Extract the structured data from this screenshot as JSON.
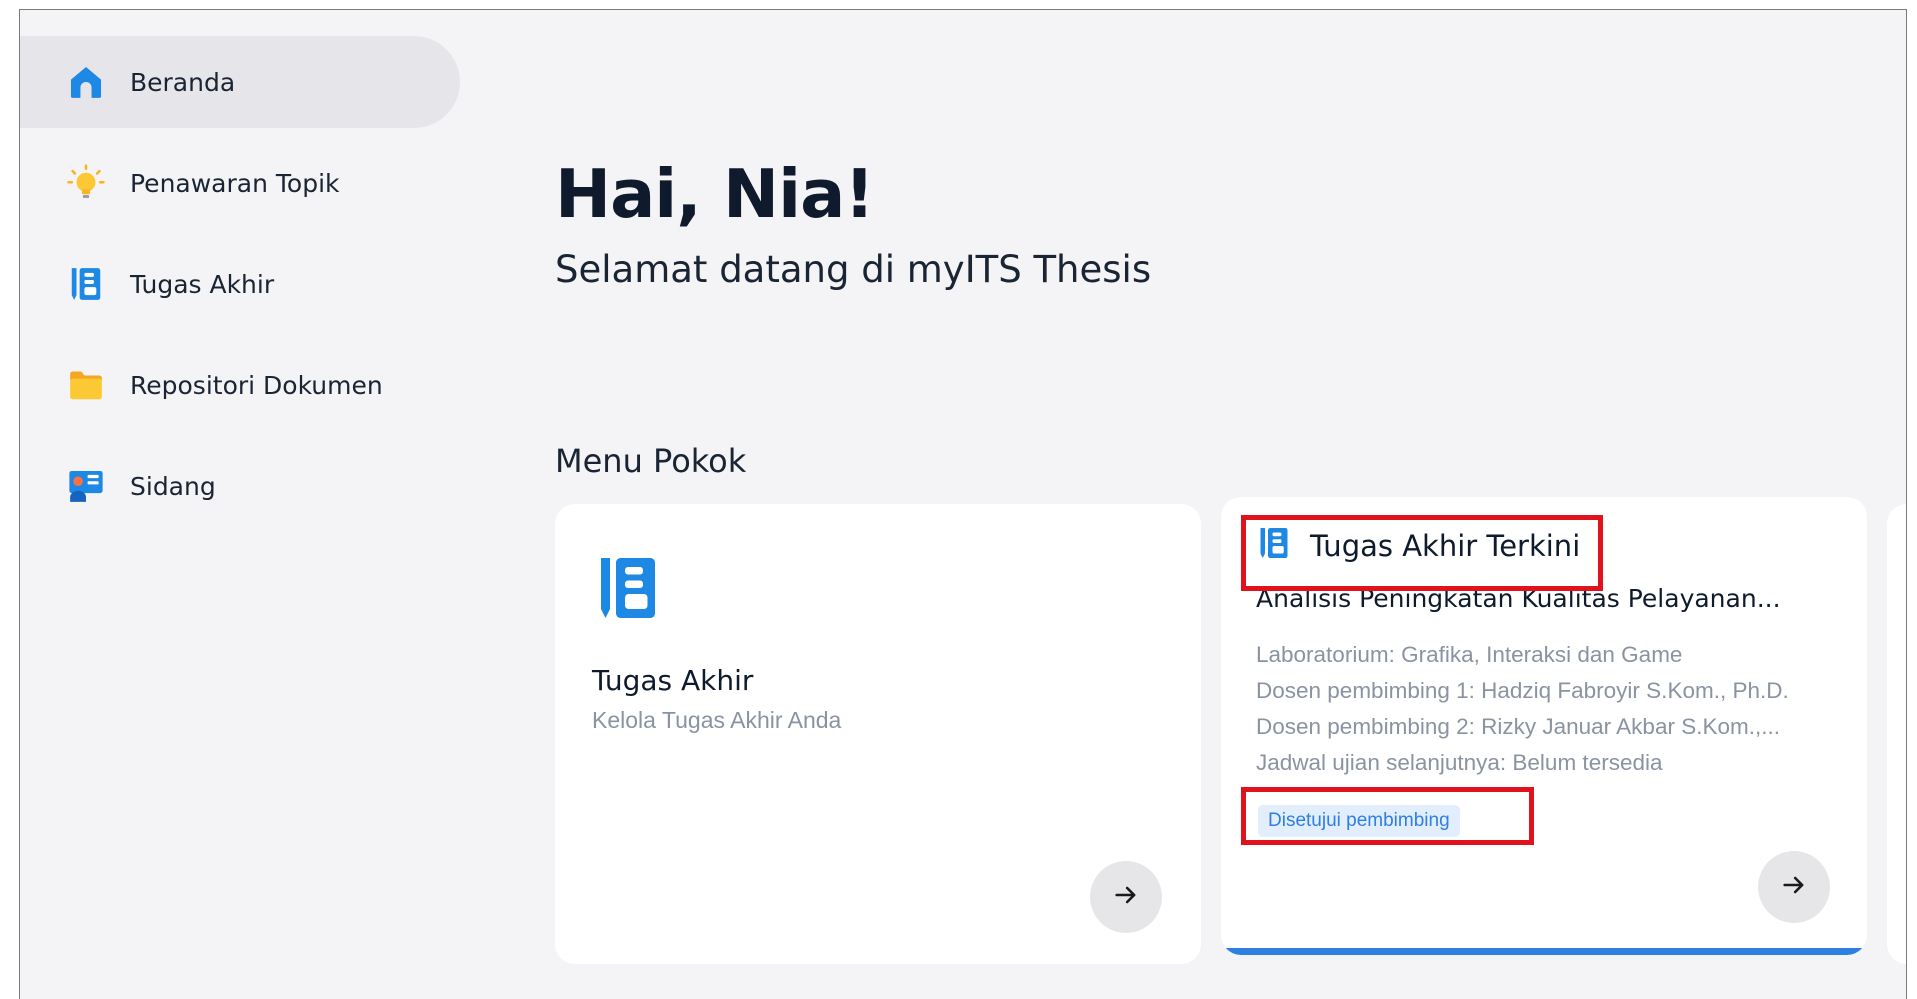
{
  "sidebar": {
    "items": [
      {
        "label": "Beranda",
        "icon": "home-icon",
        "active": true
      },
      {
        "label": "Penawaran Topik",
        "icon": "lightbulb-icon",
        "active": false
      },
      {
        "label": "Tugas Akhir",
        "icon": "notebook-icon",
        "active": false
      },
      {
        "label": "Repositori Dokumen",
        "icon": "folder-icon",
        "active": false
      },
      {
        "label": "Sidang",
        "icon": "presentation-icon",
        "active": false
      }
    ]
  },
  "main": {
    "greeting": "Hai, Nia!",
    "subtitle": "Selamat datang di myITS Thesis",
    "section_title": "Menu Pokok",
    "card_tugas_akhir": {
      "title": "Tugas Akhir",
      "description": "Kelola Tugas Akhir Anda",
      "icon": "notebook-icon"
    },
    "card_terkini": {
      "header": "Tugas Akhir Terkini",
      "thesis_title": "Analisis Peningkatan Kualitas Pelayanan...",
      "details": [
        "Laboratorium: Grafika, Interaksi dan Game",
        "Dosen pembimbing 1: Hadziq Fabroyir S.Kom., Ph.D.",
        "Dosen pembimbing 2: Rizky Januar Akbar S.Kom.,...",
        "Jadwal ujian selanjutnya: Belum tersedia"
      ],
      "status": "Disetujui pembimbing",
      "icon": "notebook-icon"
    }
  },
  "colors": {
    "accent": "#2f7fe3",
    "highlight": "#e0121c",
    "background": "#f4f4f6",
    "badge_bg": "#e3eefc"
  }
}
